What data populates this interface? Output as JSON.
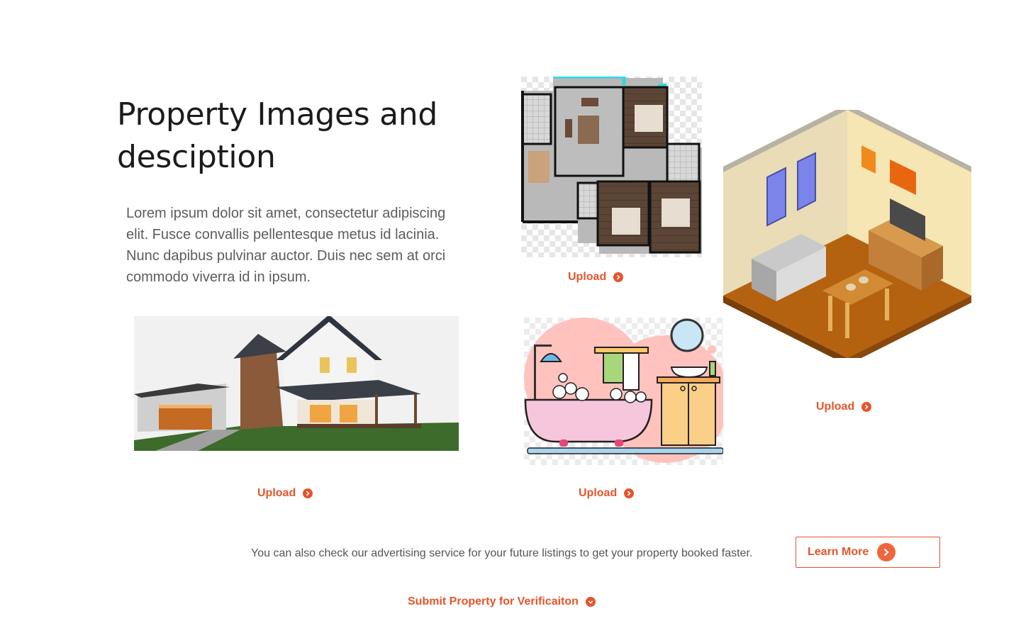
{
  "heading": "Property Images and desciption",
  "description": "Lorem ipsum dolor sit amet, consectetur adipiscing elit. Fusce convallis pellentesque metus id lacinia. Nunc dapibus pulvinar auctor. Duis nec sem at orci commodo viverra id in ipsum.",
  "uploads": {
    "floor_plan": "Upload",
    "living_room": "Upload",
    "house": "Upload",
    "bathroom": "Upload"
  },
  "promo_text": "You can also check our advertising service for your future listings to get your property booked faster.",
  "learn_more_label": "Learn More",
  "submit_label": "Submit Property for Verificaiton",
  "colors": {
    "accent": "#e5552b",
    "heading": "#1b1b1b",
    "body_text": "#5c5c5c"
  },
  "icons": {
    "upload": "chevron-right-circle-icon",
    "learn_more": "chevron-right-circle-icon",
    "submit": "chevron-down-circle-icon"
  }
}
